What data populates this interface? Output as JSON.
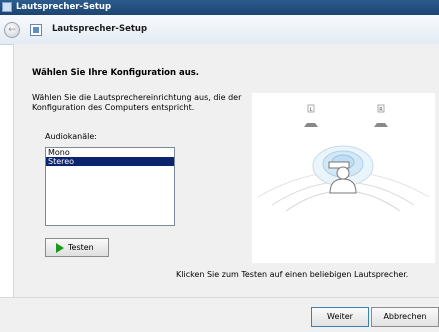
{
  "window": {
    "title": "Lautsprecher-Setup"
  },
  "nav": {
    "title": "Lautsprecher-Setup"
  },
  "page": {
    "heading": "Wählen Sie Ihre Konfiguration aus.",
    "instruction": "Wählen Sie die Lautsprechereinrichtung aus, die der Konfiguration des Computers entspricht.",
    "channels_label": "Audiokanäle:",
    "channels": [
      {
        "label": "Mono",
        "selected": false
      },
      {
        "label": "Stereo",
        "selected": true
      }
    ],
    "test_button": "Testen",
    "hint": "Klicken Sie zum Testen auf einen beliebigen Lautsprecher."
  },
  "diagram": {
    "left_speaker_label": "L",
    "right_speaker_label": "R"
  },
  "footer": {
    "next_label": "Weiter",
    "cancel_label": "Abbrechen"
  },
  "colors": {
    "selection": "#0c246e",
    "titlebar": "#1d4471",
    "play": "#1a9a1a"
  }
}
